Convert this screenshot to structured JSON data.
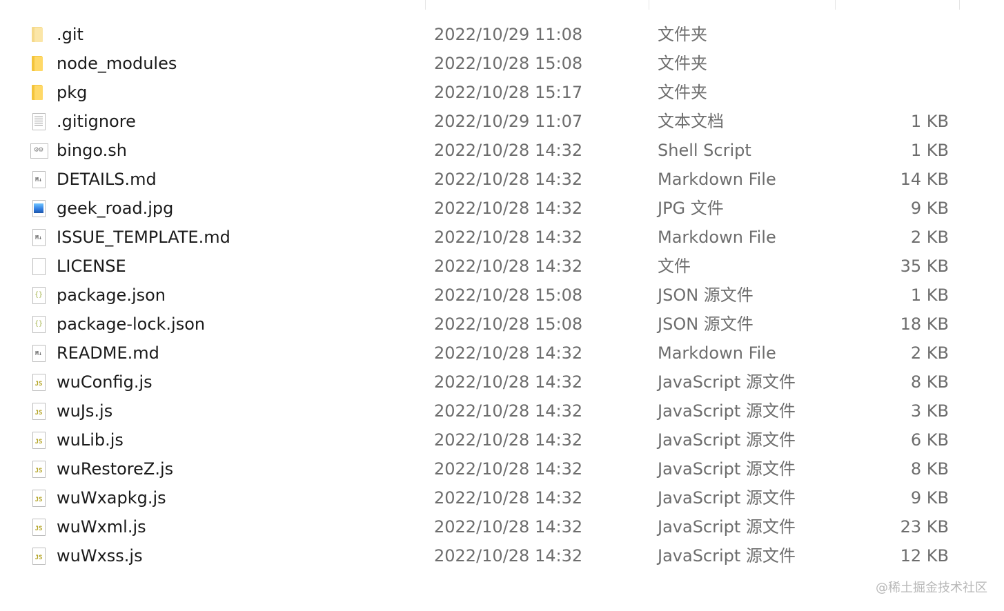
{
  "files": [
    {
      "name": ".git",
      "date": "2022/10/29 11:08",
      "type": "文件夹",
      "size": "",
      "icon": "folder-icon"
    },
    {
      "name": "node_modules",
      "date": "2022/10/28 15:08",
      "type": "文件夹",
      "size": "",
      "icon": "folder-icon"
    },
    {
      "name": "pkg",
      "date": "2022/10/28 15:17",
      "type": "文件夹",
      "size": "",
      "icon": "folder-icon"
    },
    {
      "name": ".gitignore",
      "date": "2022/10/29 11:07",
      "type": "文本文档",
      "size": "1 KB",
      "icon": "text-file-icon"
    },
    {
      "name": "bingo.sh",
      "date": "2022/10/28 14:32",
      "type": "Shell Script",
      "size": "1 KB",
      "icon": "shell-script-icon"
    },
    {
      "name": "DETAILS.md",
      "date": "2022/10/28 14:32",
      "type": "Markdown File",
      "size": "14 KB",
      "icon": "markdown-file-icon"
    },
    {
      "name": "geek_road.jpg",
      "date": "2022/10/28 14:32",
      "type": "JPG 文件",
      "size": "9 KB",
      "icon": "image-file-icon"
    },
    {
      "name": "ISSUE_TEMPLATE.md",
      "date": "2022/10/28 14:32",
      "type": "Markdown File",
      "size": "2 KB",
      "icon": "markdown-file-icon"
    },
    {
      "name": "LICENSE",
      "date": "2022/10/28 14:32",
      "type": "文件",
      "size": "35 KB",
      "icon": "blank-file-icon"
    },
    {
      "name": "package.json",
      "date": "2022/10/28 15:08",
      "type": "JSON 源文件",
      "size": "1 KB",
      "icon": "json-file-icon"
    },
    {
      "name": "package-lock.json",
      "date": "2022/10/28 15:08",
      "type": "JSON 源文件",
      "size": "18 KB",
      "icon": "json-file-icon"
    },
    {
      "name": "README.md",
      "date": "2022/10/28 14:32",
      "type": "Markdown File",
      "size": "2 KB",
      "icon": "markdown-file-icon"
    },
    {
      "name": "wuConfig.js",
      "date": "2022/10/28 14:32",
      "type": "JavaScript 源文件",
      "size": "8 KB",
      "icon": "js-file-icon"
    },
    {
      "name": "wuJs.js",
      "date": "2022/10/28 14:32",
      "type": "JavaScript 源文件",
      "size": "3 KB",
      "icon": "js-file-icon"
    },
    {
      "name": "wuLib.js",
      "date": "2022/10/28 14:32",
      "type": "JavaScript 源文件",
      "size": "6 KB",
      "icon": "js-file-icon"
    },
    {
      "name": "wuRestoreZ.js",
      "date": "2022/10/28 14:32",
      "type": "JavaScript 源文件",
      "size": "8 KB",
      "icon": "js-file-icon"
    },
    {
      "name": "wuWxapkg.js",
      "date": "2022/10/28 14:32",
      "type": "JavaScript 源文件",
      "size": "9 KB",
      "icon": "js-file-icon"
    },
    {
      "name": "wuWxml.js",
      "date": "2022/10/28 14:32",
      "type": "JavaScript 源文件",
      "size": "23 KB",
      "icon": "js-file-icon"
    },
    {
      "name": "wuWxss.js",
      "date": "2022/10/28 14:32",
      "type": "JavaScript 源文件",
      "size": "12 KB",
      "icon": "js-file-icon"
    }
  ],
  "watermark": "@稀土掘金技术社区"
}
